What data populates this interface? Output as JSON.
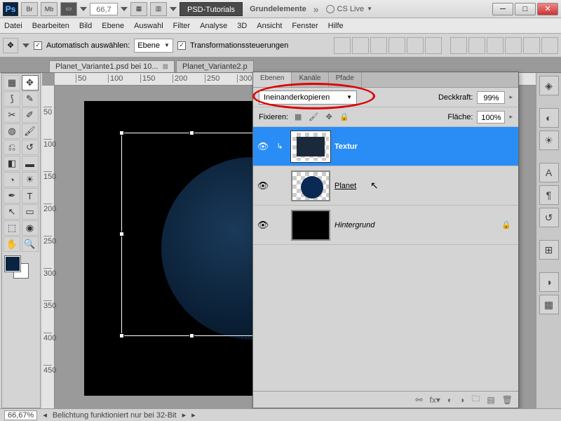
{
  "top": {
    "ps": "Ps",
    "btns": [
      "Br",
      "Mb"
    ],
    "zoom": "66,7",
    "title_dark": "PSD-Tutorials",
    "title_txt": "Grundelemente",
    "cs": "CS Live"
  },
  "menu": [
    "Datei",
    "Bearbeiten",
    "Bild",
    "Ebene",
    "Auswahl",
    "Filter",
    "Analyse",
    "3D",
    "Ansicht",
    "Fenster",
    "Hilfe"
  ],
  "opt": {
    "auto": "Automatisch auswählen:",
    "combo": "Ebene",
    "trans": "Transformationssteuerungen"
  },
  "tabs": [
    {
      "label": "Planet_Variante1.psd bei 10...",
      "active": true
    },
    {
      "label": "Planet_Variante2.p",
      "active": false
    }
  ],
  "ruler_h": [
    "50",
    "100",
    "150",
    "200",
    "250",
    "300"
  ],
  "ruler_v": [
    "50",
    "100",
    "150",
    "200",
    "250",
    "300",
    "350",
    "400",
    "450"
  ],
  "panel": {
    "tabs": [
      "Ebenen",
      "Kanäle",
      "Pfade"
    ],
    "blend": "Ineinanderkopieren",
    "opacity_lbl": "Deckkraft:",
    "opacity": "99%",
    "lock_lbl": "Fixieren:",
    "fill_lbl": "Fläche:",
    "fill": "100%",
    "layers": [
      {
        "name": "Textur",
        "sel": true
      },
      {
        "name": "Planet",
        "sel": false,
        "underline": true
      },
      {
        "name": "Hintergrund",
        "sel": false,
        "italic": true,
        "locked": true
      }
    ]
  },
  "status": {
    "zoom": "66,67%",
    "msg": "Belichtung funktioniert nur bei 32-Bit"
  }
}
